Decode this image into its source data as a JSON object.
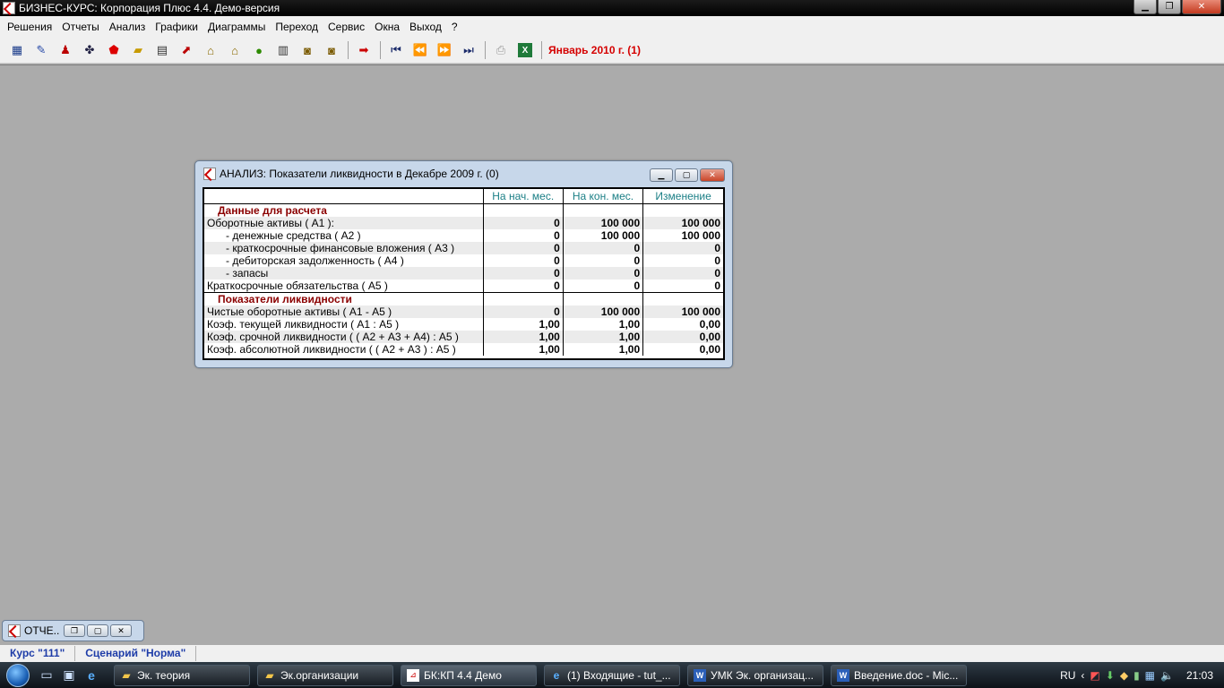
{
  "app": {
    "title": "БИЗНЕС-КУРС: Корпорация Плюс 4.4. Демо-версия"
  },
  "menu": [
    "Решения",
    "Отчеты",
    "Анализ",
    "Графики",
    "Диаграммы",
    "Переход",
    "Сервис",
    "Окна",
    "Выход",
    "?"
  ],
  "toolbar": {
    "period": "Январь 2010 г. (1)"
  },
  "window": {
    "title": "АНАЛИЗ: Показатели ликвидности в Декабре 2009 г. (0)",
    "columns": [
      "",
      "На нач. мес.",
      "На кон. мес.",
      "Изменение"
    ],
    "section1": "Данные для расчета",
    "rows1": [
      {
        "label": "Оборотные активы ( А1 ):",
        "v": [
          "0",
          "100 000",
          "100 000"
        ]
      },
      {
        "label": "- денежные средства ( А2 )",
        "v": [
          "0",
          "100 000",
          "100 000"
        ]
      },
      {
        "label": "- краткосрочные финансовые вложения ( А3 )",
        "v": [
          "0",
          "0",
          "0"
        ]
      },
      {
        "label": "- дебиторская задолженность ( А4 )",
        "v": [
          "0",
          "0",
          "0"
        ]
      },
      {
        "label": "- запасы",
        "v": [
          "0",
          "0",
          "0"
        ]
      },
      {
        "label": "Краткосрочные обязательства ( А5 )",
        "v": [
          "0",
          "0",
          "0"
        ]
      }
    ],
    "section2": "Показатели ликвидности",
    "rows2": [
      {
        "label": "Чистые оборотные активы ( А1 - А5 )",
        "v": [
          "0",
          "100 000",
          "100 000"
        ]
      },
      {
        "label": "Коэф. текущей ликвидности ( А1 : А5 )",
        "v": [
          "1,00",
          "1,00",
          "0,00"
        ]
      },
      {
        "label": "Коэф. срочной ликвидности ( ( А2 + А3 + А4) : А5 )",
        "v": [
          "1,00",
          "1,00",
          "0,00"
        ]
      },
      {
        "label": "Коэф. абсолютной ликвидности ( ( А2 + А3 ) : А5 )",
        "v": [
          "1,00",
          "1,00",
          "0,00"
        ]
      }
    ]
  },
  "minimized": {
    "title": "ОТЧЕ..."
  },
  "status": {
    "course": "Курс \"111\"",
    "scenario": "Сценарий \"Норма\""
  },
  "taskbar": {
    "tasks": [
      {
        "label": "Эк. теория",
        "active": false
      },
      {
        "label": "Эк.организации",
        "active": false
      },
      {
        "label": "БК:КП 4.4 Демо",
        "active": true
      },
      {
        "label": "(1) Входящие - tut_...",
        "active": false
      },
      {
        "label": "УМК Эк. организац...",
        "active": false
      },
      {
        "label": "Введение.doc - Mic...",
        "active": false
      }
    ],
    "lang": "RU",
    "clock": "21:03"
  }
}
